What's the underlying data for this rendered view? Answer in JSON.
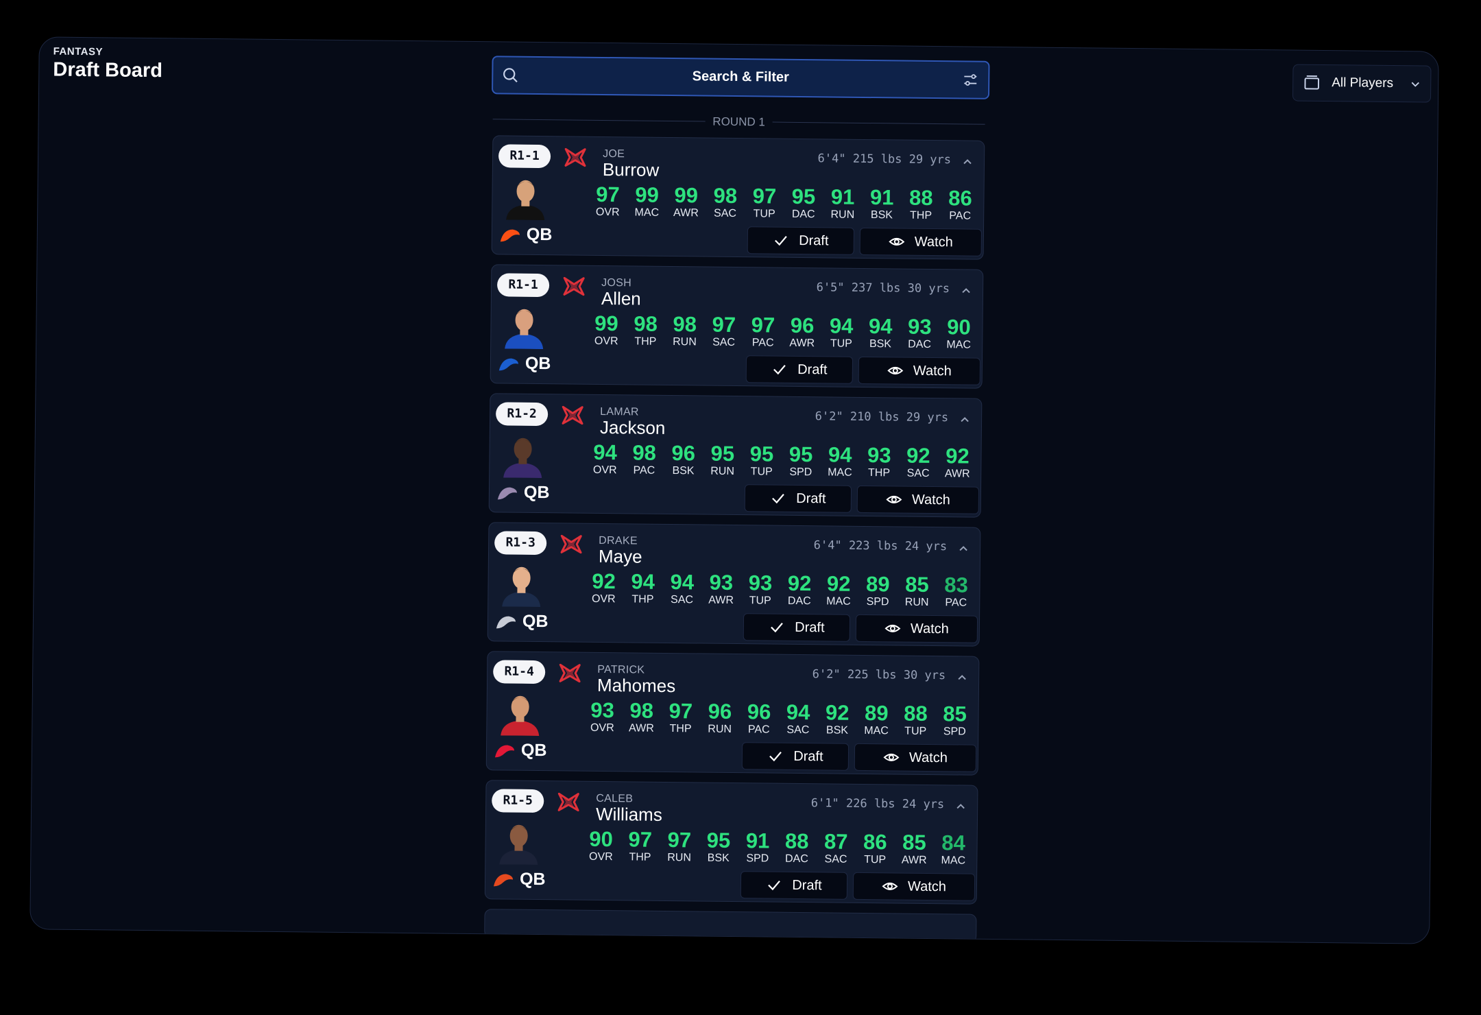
{
  "header": {
    "brand_small": "FANTASY",
    "brand_title": "Draft Board"
  },
  "search": {
    "label": "Search & Filter"
  },
  "filter": {
    "label": "All Players"
  },
  "round": {
    "label": "ROUND 1"
  },
  "buttons": {
    "draft": "Draft",
    "watch": "Watch"
  },
  "colors": {
    "accent": "#2ee27f",
    "search_border": "#2f57b4",
    "favorite": "#e0313a"
  },
  "players": [
    {
      "pick": "R1-1",
      "first": "JOE",
      "last": "Burrow",
      "meas": "6'4\" 215 lbs 29 yrs",
      "pos": "QB",
      "team_icon": "bengals-logo-icon",
      "team_color": "#fb4f14",
      "stats": [
        {
          "v": "97",
          "k": "OVR"
        },
        {
          "v": "99",
          "k": "MAC"
        },
        {
          "v": "99",
          "k": "AWR"
        },
        {
          "v": "98",
          "k": "SAC"
        },
        {
          "v": "97",
          "k": "TUP"
        },
        {
          "v": "95",
          "k": "DAC"
        },
        {
          "v": "91",
          "k": "RUN"
        },
        {
          "v": "91",
          "k": "BSK"
        },
        {
          "v": "88",
          "k": "THP"
        },
        {
          "v": "86",
          "k": "PAC"
        }
      ]
    },
    {
      "pick": "R1-1",
      "first": "JOSH",
      "last": "Allen",
      "meas": "6'5\" 237 lbs 30 yrs",
      "pos": "QB",
      "team_icon": "bills-logo-icon",
      "team_color": "#1b5fd1",
      "stats": [
        {
          "v": "99",
          "k": "OVR"
        },
        {
          "v": "98",
          "k": "THP"
        },
        {
          "v": "98",
          "k": "RUN"
        },
        {
          "v": "97",
          "k": "SAC"
        },
        {
          "v": "97",
          "k": "PAC"
        },
        {
          "v": "96",
          "k": "AWR"
        },
        {
          "v": "94",
          "k": "TUP"
        },
        {
          "v": "94",
          "k": "BSK"
        },
        {
          "v": "93",
          "k": "DAC"
        },
        {
          "v": "90",
          "k": "MAC"
        }
      ]
    },
    {
      "pick": "R1-2",
      "first": "LAMAR",
      "last": "Jackson",
      "meas": "6'2\" 210 lbs 29 yrs",
      "pos": "QB",
      "team_icon": "ravens-logo-icon",
      "team_color": "#9a8ab0",
      "stats": [
        {
          "v": "94",
          "k": "OVR"
        },
        {
          "v": "98",
          "k": "PAC"
        },
        {
          "v": "96",
          "k": "BSK"
        },
        {
          "v": "95",
          "k": "RUN"
        },
        {
          "v": "95",
          "k": "TUP"
        },
        {
          "v": "95",
          "k": "SPD"
        },
        {
          "v": "94",
          "k": "MAC"
        },
        {
          "v": "93",
          "k": "THP"
        },
        {
          "v": "92",
          "k": "SAC"
        },
        {
          "v": "92",
          "k": "AWR"
        }
      ]
    },
    {
      "pick": "R1-3",
      "first": "DRAKE",
      "last": "Maye",
      "meas": "6'4\" 223 lbs 24 yrs",
      "pos": "QB",
      "team_icon": "patriots-logo-icon",
      "team_color": "#c8ccd6",
      "stats": [
        {
          "v": "92",
          "k": "OVR"
        },
        {
          "v": "94",
          "k": "THP"
        },
        {
          "v": "94",
          "k": "SAC"
        },
        {
          "v": "93",
          "k": "AWR"
        },
        {
          "v": "93",
          "k": "TUP"
        },
        {
          "v": "92",
          "k": "DAC"
        },
        {
          "v": "92",
          "k": "MAC"
        },
        {
          "v": "89",
          "k": "SPD"
        },
        {
          "v": "85",
          "k": "RUN"
        },
        {
          "v": "83",
          "k": "PAC"
        }
      ]
    },
    {
      "pick": "R1-4",
      "first": "PATRICK",
      "last": "Mahomes",
      "meas": "6'2\" 225 lbs 30 yrs",
      "pos": "QB",
      "team_icon": "chiefs-logo-icon",
      "team_color": "#e31837",
      "stats": [
        {
          "v": "93",
          "k": "OVR"
        },
        {
          "v": "98",
          "k": "AWR"
        },
        {
          "v": "97",
          "k": "THP"
        },
        {
          "v": "96",
          "k": "RUN"
        },
        {
          "v": "96",
          "k": "PAC"
        },
        {
          "v": "94",
          "k": "SAC"
        },
        {
          "v": "92",
          "k": "BSK"
        },
        {
          "v": "89",
          "k": "MAC"
        },
        {
          "v": "88",
          "k": "TUP"
        },
        {
          "v": "85",
          "k": "SPD"
        }
      ]
    },
    {
      "pick": "R1-5",
      "first": "CALEB",
      "last": "Williams",
      "meas": "6'1\" 226 lbs 24 yrs",
      "pos": "QB",
      "team_icon": "bears-logo-icon",
      "team_color": "#e64a1f",
      "stats": [
        {
          "v": "90",
          "k": "OVR"
        },
        {
          "v": "97",
          "k": "THP"
        },
        {
          "v": "97",
          "k": "RUN"
        },
        {
          "v": "95",
          "k": "BSK"
        },
        {
          "v": "91",
          "k": "SPD"
        },
        {
          "v": "88",
          "k": "DAC"
        },
        {
          "v": "87",
          "k": "SAC"
        },
        {
          "v": "86",
          "k": "TUP"
        },
        {
          "v": "85",
          "k": "AWR"
        },
        {
          "v": "84",
          "k": "MAC"
        }
      ]
    }
  ]
}
